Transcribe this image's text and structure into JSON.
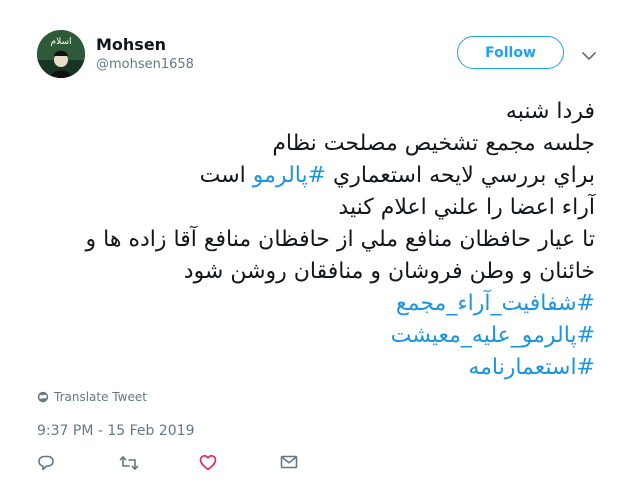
{
  "user": {
    "name": "Mohsen",
    "handle": "@mohsen1658",
    "avatar_text": "اسلام"
  },
  "follow_button": {
    "label": "Follow"
  },
  "tweet": {
    "lines": [
      [
        {
          "t": "فردا شنبه"
        }
      ],
      [
        {
          "t": "جلسه مجمع تشخيص مصلحت نظام"
        }
      ],
      [
        {
          "t": "براي بررسي لايحه استعماري "
        },
        {
          "t": "#پالرمو",
          "tag": true
        },
        {
          "t": "  است"
        }
      ],
      [
        {
          "t": "آراء اعضا را علني اعلام كنيد"
        }
      ],
      [
        {
          "t": "تا عيار حافظان منافع ملي  از حافظان منافع آقا زاده ها  و"
        }
      ],
      [
        {
          "t": "خائنان و وطن فروشان و منافقان روشن شود"
        }
      ],
      [
        {
          "t": "#شفافيت_آراء_مجمع",
          "tag": true
        }
      ],
      [
        {
          "t": "#پالرمو_عليه_معيشت",
          "tag": true
        }
      ],
      [
        {
          "t": "#استعمارنامه",
          "tag": true
        }
      ]
    ]
  },
  "translate_label": "Translate Tweet",
  "timestamp": "9:37 PM - 15 Feb 2019",
  "colors": {
    "accent": "#1da1f2",
    "hashtag": "#1b95e0",
    "muted": "#657786",
    "like": "#e0245e"
  },
  "icons": {
    "reply": "reply-icon",
    "retweet": "retweet-icon",
    "like": "heart-icon",
    "dm": "envelope-icon",
    "translate": "globe-icon",
    "caret": "chevron-down-icon"
  }
}
